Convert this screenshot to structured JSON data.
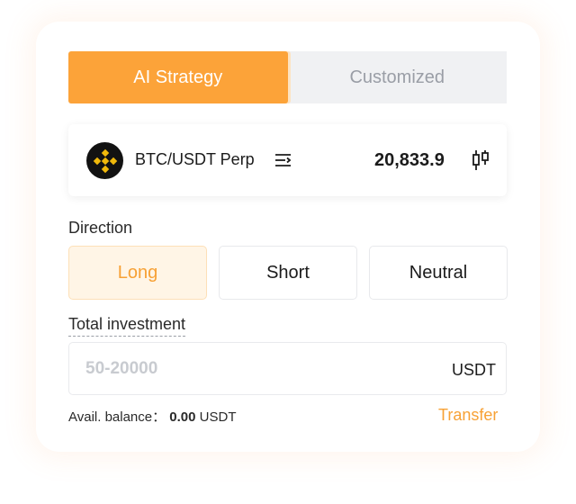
{
  "tabs": [
    {
      "label": "AI Strategy",
      "active": true
    },
    {
      "label": "Customized",
      "active": false
    }
  ],
  "pair": {
    "name": "BTC/USDT Perp",
    "price": "20,833.9",
    "logo_icon": "binance-logo-icon",
    "menu_icon": "list-menu-icon",
    "chart_icon": "candlestick-chart-icon"
  },
  "direction": {
    "label": "Direction",
    "options": [
      {
        "label": "Long",
        "selected": true
      },
      {
        "label": "Short",
        "selected": false
      },
      {
        "label": "Neutral",
        "selected": false
      }
    ]
  },
  "investment": {
    "label": "Total investment",
    "placeholder": "50-20000",
    "value": "",
    "unit": "USDT"
  },
  "balance": {
    "label": "Avail. balance：",
    "value": "0.00",
    "unit": "USDT"
  },
  "transfer_label": "Transfer",
  "colors": {
    "accent": "#fca339",
    "accent_text": "#f7a135",
    "selected_bg": "#fff5e6",
    "inactive_tab_bg": "#f0f1f3",
    "binance_yellow": "#f0b90b"
  }
}
